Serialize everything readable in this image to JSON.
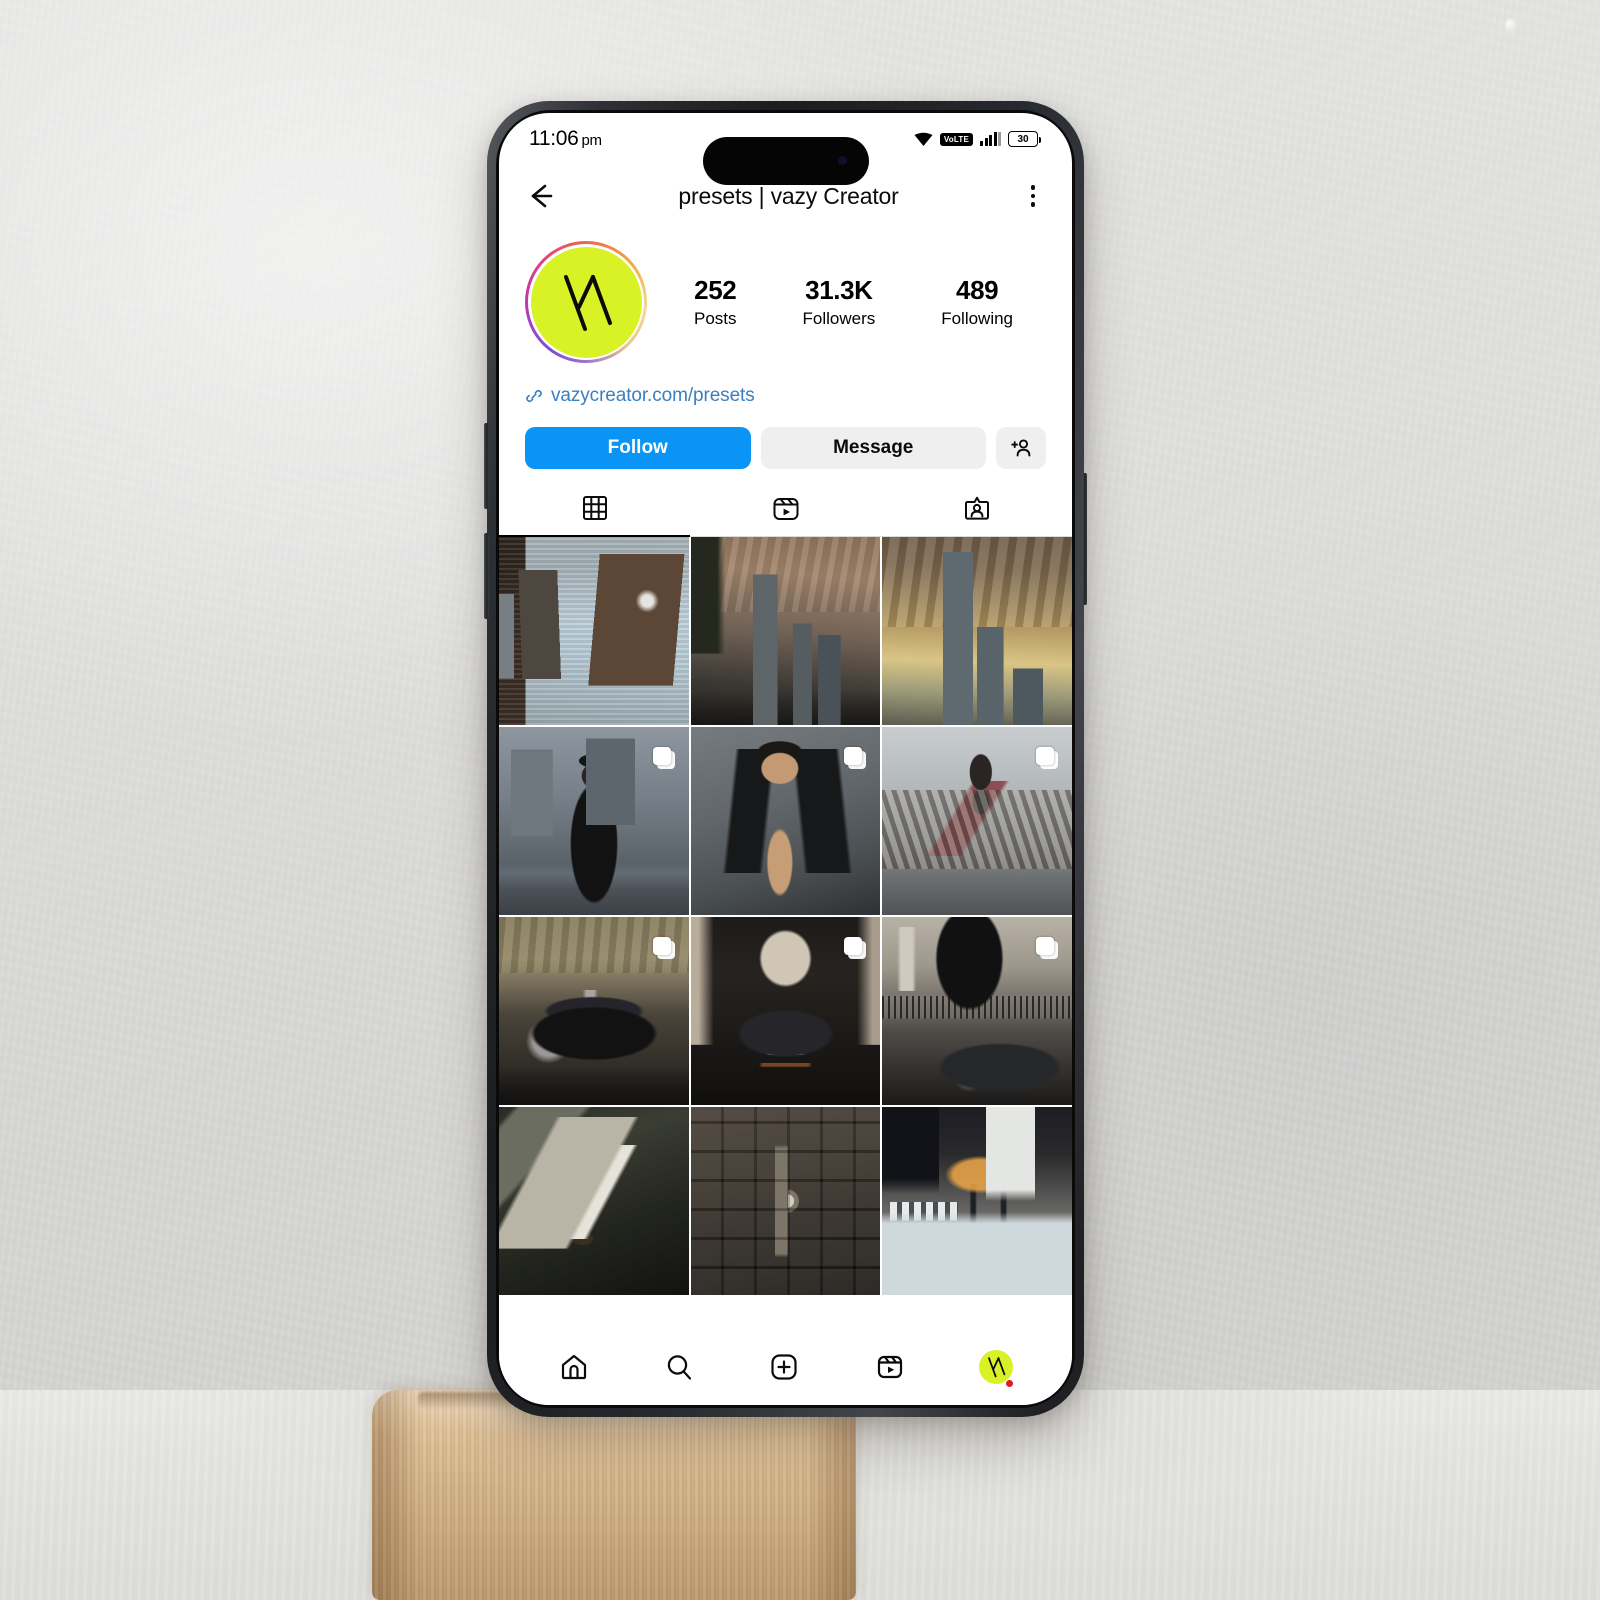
{
  "scene": {
    "description": "smartphone on wooden stand against concrete wall",
    "wall_color": "#dcdcda",
    "wood_color": "#d6b78c",
    "phone_frame_color": "#2d3034"
  },
  "status_bar": {
    "time": "11:06",
    "ampm": "pm",
    "wifi_icon": "wifi-icon",
    "volte_label": "VoLTE",
    "signal_icon": "signal-bars-icon",
    "battery_level": "30"
  },
  "header": {
    "back_icon": "back-arrow-icon",
    "title": "presets | vazy Creator",
    "menu_icon": "kebab-menu-icon"
  },
  "profile": {
    "avatar_name": "profile-avatar",
    "avatar_bg": "#d9f226",
    "avatar_monogram": "VA",
    "has_story_ring": true,
    "stats": [
      {
        "value": "252",
        "label": "Posts"
      },
      {
        "value": "31.3K",
        "label": "Followers"
      },
      {
        "value": "489",
        "label": "Following"
      }
    ],
    "link_icon": "link-chain-icon",
    "link_text": "vazycreator.com/presets",
    "link_color": "#3a7fbf"
  },
  "actions": {
    "follow_label": "Follow",
    "follow_color": "#0a95f6",
    "message_label": "Message",
    "message_color": "#efefef",
    "add_user_icon": "person-add-icon"
  },
  "tabs": [
    {
      "name": "grid",
      "icon": "grid-icon",
      "active": true
    },
    {
      "name": "reels",
      "icon": "reels-icon",
      "active": false
    },
    {
      "name": "tagged",
      "icon": "tagged-person-icon",
      "active": false
    }
  ],
  "grid": {
    "columns": 3,
    "posts": [
      {
        "id": "p1",
        "art": "a-nyc1",
        "subject": "New York Flatiron and Empire State Building",
        "carousel": false
      },
      {
        "id": "p2",
        "art": "a-nyc2",
        "subject": "Chicago skyline with warm clouds",
        "carousel": false
      },
      {
        "id": "p3",
        "art": "a-nyc3",
        "subject": "High-rise tower at golden sunset",
        "carousel": false
      },
      {
        "id": "p4",
        "art": "a-fa1",
        "subject": "Woman in black outfit with cap on rooftop",
        "carousel": true
      },
      {
        "id": "p5",
        "art": "a-fa2",
        "subject": "Man in open black jacket portrait",
        "carousel": true
      },
      {
        "id": "p6",
        "art": "a-fa3",
        "subject": "Woman posing on wooden boardwalk",
        "carousel": true
      },
      {
        "id": "p7",
        "art": "a-car1",
        "subject": "Black Mustang Shelby sports car",
        "carousel": true
      },
      {
        "id": "p8",
        "art": "a-car2",
        "subject": "Supercar in dark stone alley",
        "carousel": true
      },
      {
        "id": "p9",
        "art": "a-car3",
        "subject": "Dark supercar parked by arched building",
        "carousel": true
      },
      {
        "id": "p10",
        "art": "a-lx1",
        "subject": "Suit sleeve with wristwatch detail",
        "carousel": false
      },
      {
        "id": "p11",
        "art": "a-lx2",
        "subject": "Luxury watch on dark leather",
        "carousel": false
      },
      {
        "id": "p12",
        "art": "a-lx3",
        "subject": "Rooftop pool at dusk with city skyline",
        "carousel": false
      }
    ]
  },
  "bottom_nav": [
    {
      "name": "home",
      "icon": "home-icon"
    },
    {
      "name": "search",
      "icon": "search-icon"
    },
    {
      "name": "create",
      "icon": "plus-square-icon"
    },
    {
      "name": "reels",
      "icon": "reels-icon"
    },
    {
      "name": "profile",
      "icon": "profile-avatar-icon",
      "badge": true
    }
  ]
}
